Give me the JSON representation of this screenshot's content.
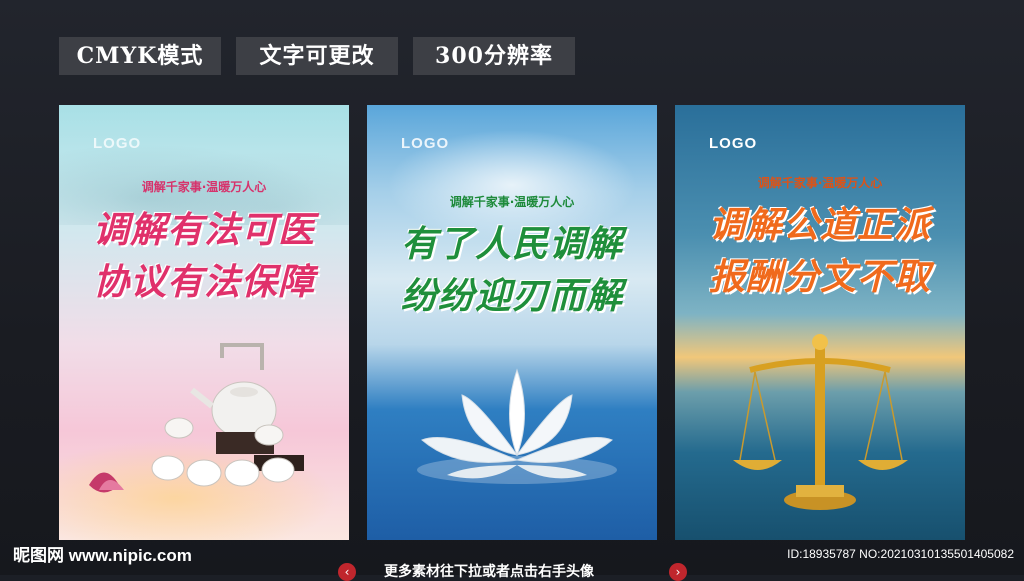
{
  "tags": [
    "CMYK模式",
    "文字可更改",
    "300分辨率"
  ],
  "posters": [
    {
      "logo": "LOGO",
      "slogan": "调解千家事·温暖万人心",
      "line1": "调解有法可医",
      "line2": "协议有法保障"
    },
    {
      "logo": "LOGO",
      "slogan": "调解千家事·温暖万人心",
      "line1": "有了人民调解",
      "line2": "纷纷迎刃而解"
    },
    {
      "logo": "LOGO",
      "slogan": "调解千家事·温暖万人心",
      "line1": "调解公道正派",
      "line2": "报酬分文不取"
    }
  ],
  "footer": {
    "site": "昵图网 www.nipic.com",
    "id_text": "ID:18935787 NO:20210310135501405082",
    "more": "更多素材往下拉或者点击右手头像"
  },
  "icons": {
    "prev": "chevron-left-icon",
    "next": "chevron-right-icon"
  }
}
